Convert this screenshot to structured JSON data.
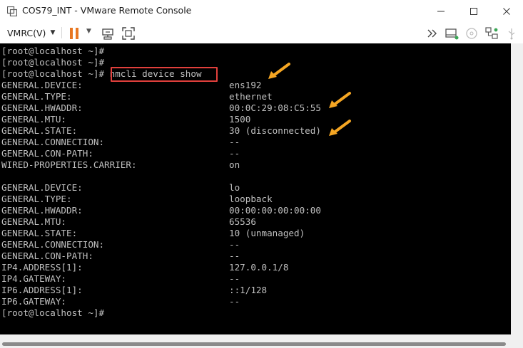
{
  "window": {
    "title": "COS79_INT - VMware Remote Console"
  },
  "toolbar": {
    "vmrc_menu": "VMRC(V)",
    "icons": [
      "pause-icon",
      "send-ctrl-alt-del-icon",
      "fit-screen-icon",
      "forward-icon",
      "removable-devices-icon",
      "cd-icon",
      "network-icon",
      "usb-icon"
    ]
  },
  "colors": {
    "terminal_bg": "#000000",
    "terminal_fg": "#c0c0c0",
    "highlight_box": "#e2403c",
    "arrow": "#f5a623",
    "pause": "#e87722"
  },
  "terminal": {
    "lines": [
      {
        "key": "[root@localhost ~]#",
        "value": ""
      },
      {
        "key": "[root@localhost ~]#",
        "value": ""
      },
      {
        "key": "[root@localhost ~]# nmcli device show",
        "value": ""
      },
      {
        "key": "GENERAL.DEVICE:",
        "value": "ens192"
      },
      {
        "key": "GENERAL.TYPE:",
        "value": "ethernet"
      },
      {
        "key": "GENERAL.HWADDR:",
        "value": "00:0C:29:08:C5:55"
      },
      {
        "key": "GENERAL.MTU:",
        "value": "1500"
      },
      {
        "key": "GENERAL.STATE:",
        "value": "30 (disconnected)"
      },
      {
        "key": "GENERAL.CONNECTION:",
        "value": "--"
      },
      {
        "key": "GENERAL.CON-PATH:",
        "value": "--"
      },
      {
        "key": "WIRED-PROPERTIES.CARRIER:",
        "value": "on"
      },
      {
        "key": "",
        "value": ""
      },
      {
        "key": "GENERAL.DEVICE:",
        "value": "lo"
      },
      {
        "key": "GENERAL.TYPE:",
        "value": "loopback"
      },
      {
        "key": "GENERAL.HWADDR:",
        "value": "00:00:00:00:00:00"
      },
      {
        "key": "GENERAL.MTU:",
        "value": "65536"
      },
      {
        "key": "GENERAL.STATE:",
        "value": "10 (unmanaged)"
      },
      {
        "key": "GENERAL.CONNECTION:",
        "value": "--"
      },
      {
        "key": "GENERAL.CON-PATH:",
        "value": "--"
      },
      {
        "key": "IP4.ADDRESS[1]:",
        "value": "127.0.0.1/8"
      },
      {
        "key": "IP4.GATEWAY:",
        "value": "--"
      },
      {
        "key": "IP6.ADDRESS[1]:",
        "value": "::1/128"
      },
      {
        "key": "IP6.GATEWAY:",
        "value": "--"
      },
      {
        "key": "[root@localhost ~]#",
        "value": ""
      }
    ]
  }
}
